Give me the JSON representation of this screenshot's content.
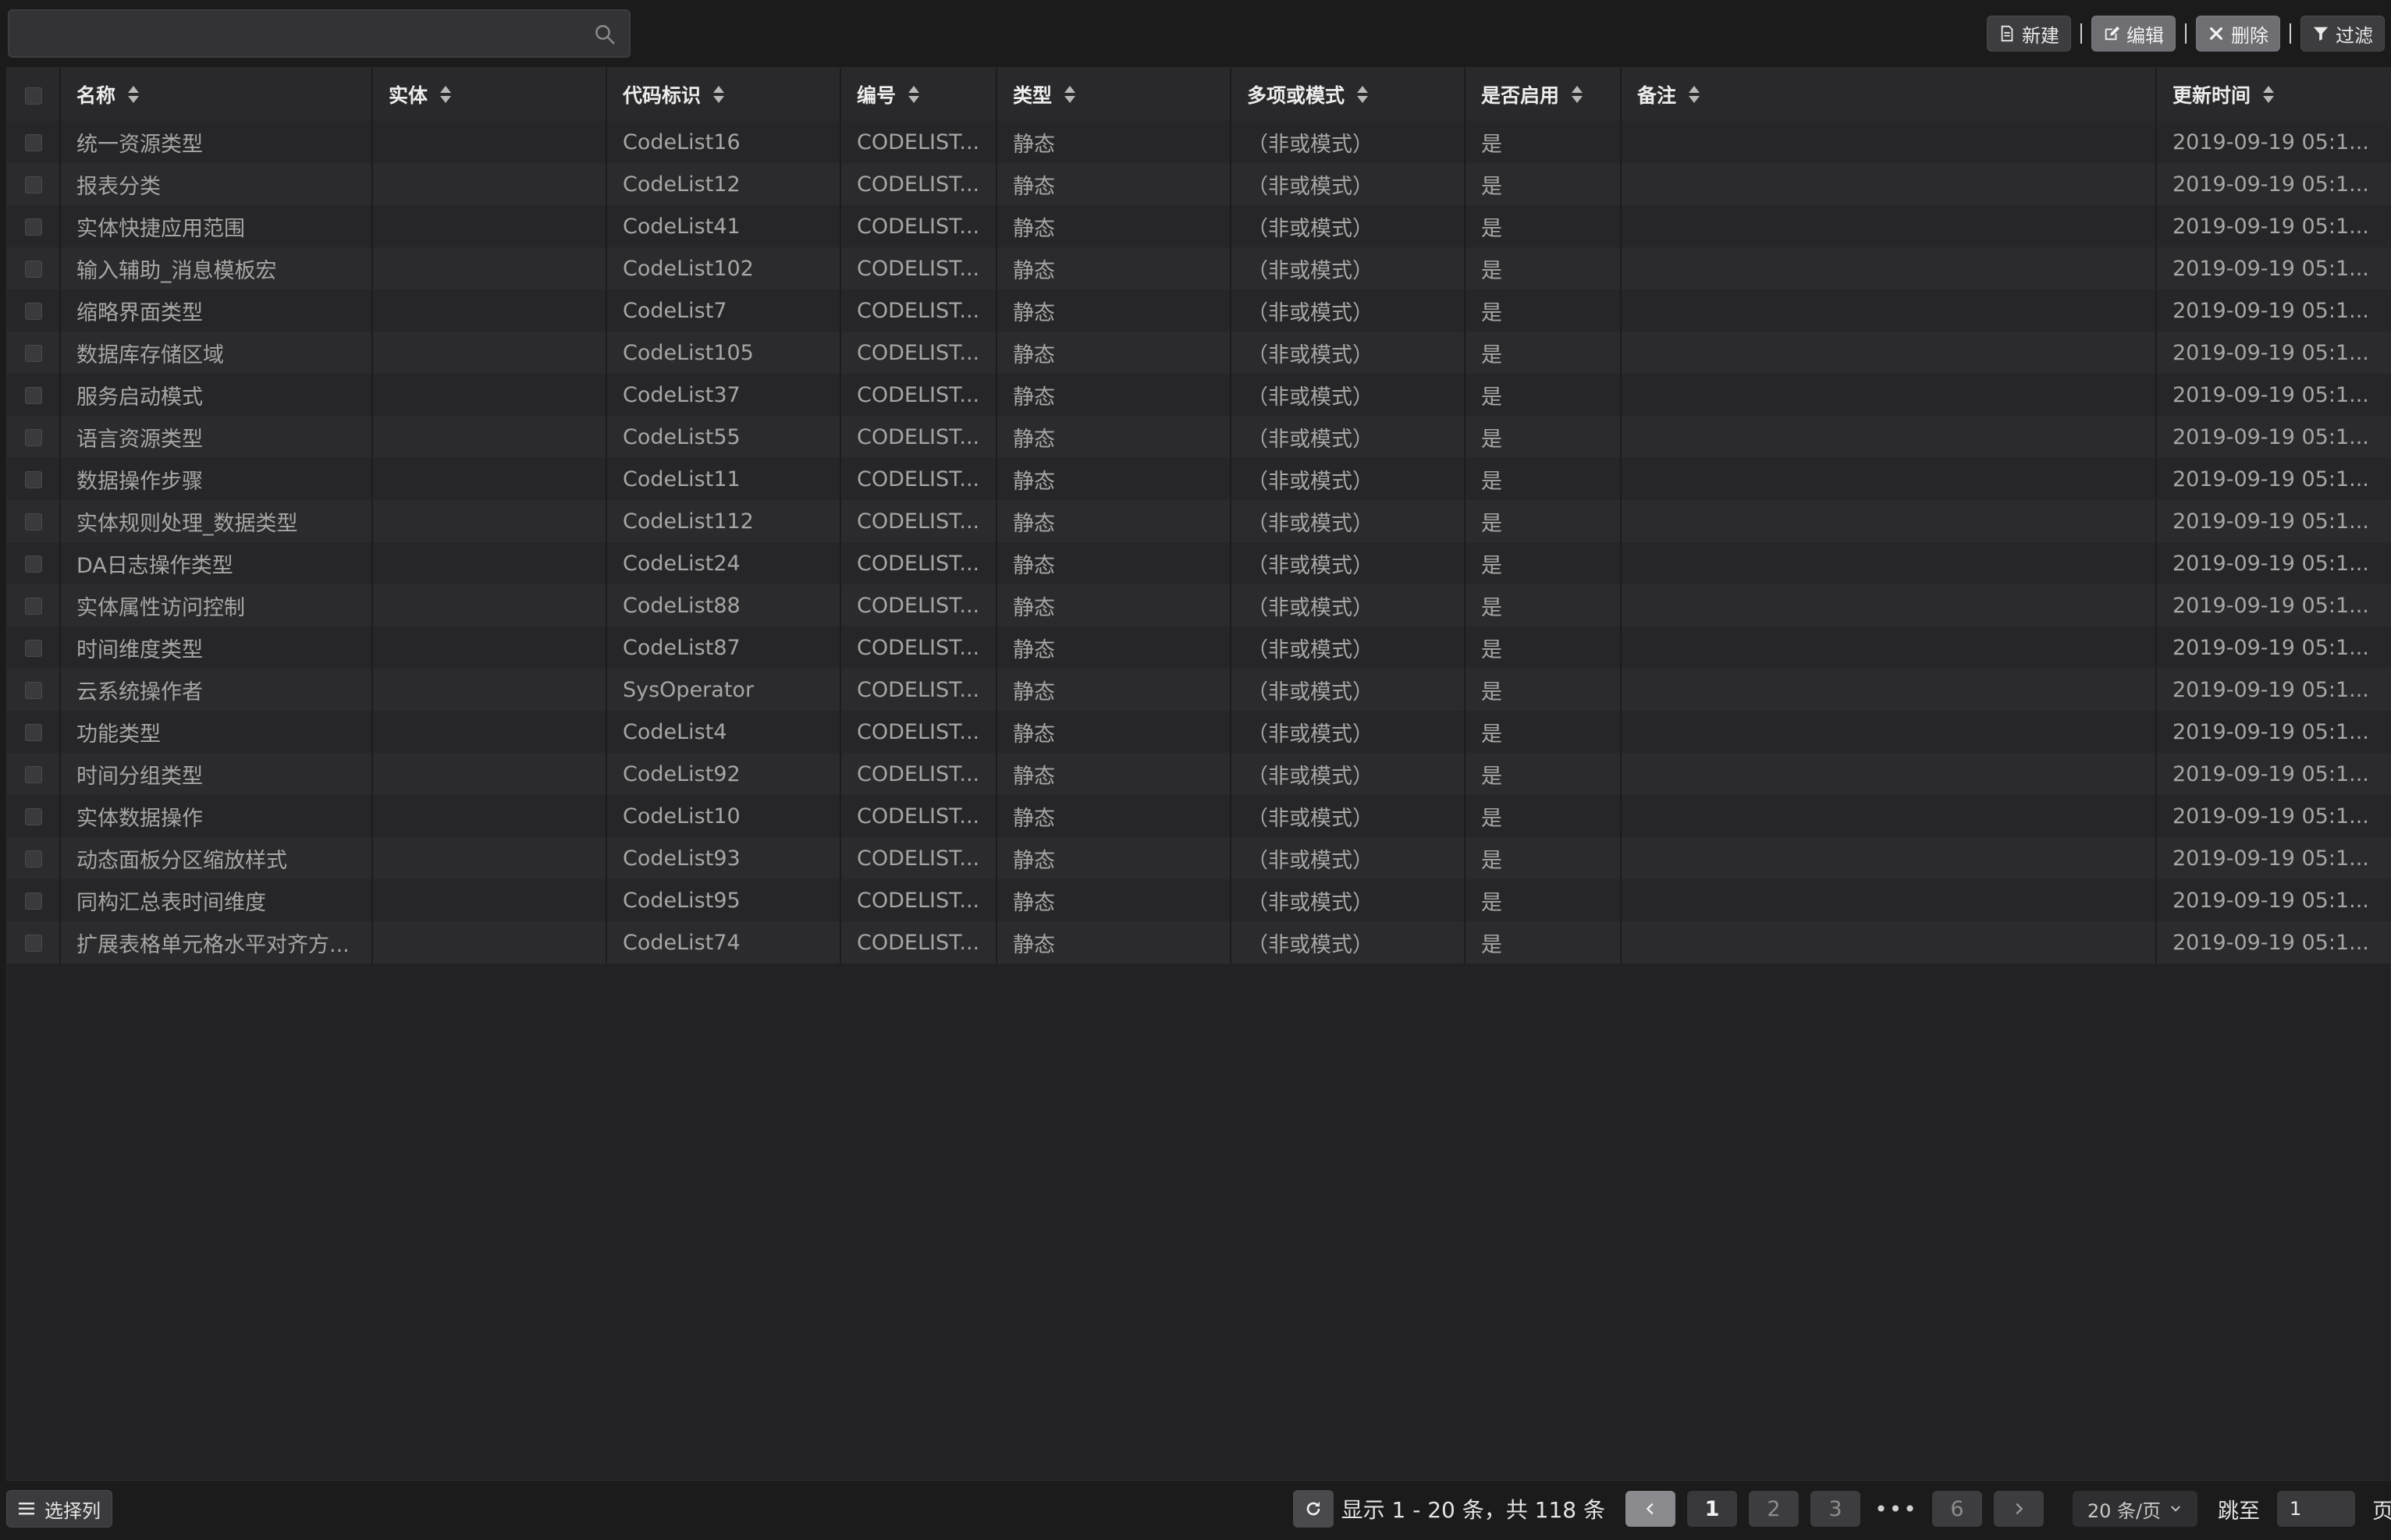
{
  "search": {
    "placeholder": "",
    "value": ""
  },
  "toolbar": {
    "new_label": "新建",
    "edit_label": "编辑",
    "delete_label": "删除",
    "filter_label": "过滤"
  },
  "table": {
    "columns": [
      "名称",
      "实体",
      "代码标识",
      "编号",
      "类型",
      "多项或模式",
      "是否启用",
      "备注",
      "更新时间"
    ],
    "rows": [
      [
        "统一资源类型",
        "",
        "CodeList16",
        "CODELIST...",
        "静态",
        "（非或模式）",
        "是",
        "",
        "2019-09-19 05:1..."
      ],
      [
        "报表分类",
        "",
        "CodeList12",
        "CODELIST...",
        "静态",
        "（非或模式）",
        "是",
        "",
        "2019-09-19 05:1..."
      ],
      [
        "实体快捷应用范围",
        "",
        "CodeList41",
        "CODELIST...",
        "静态",
        "（非或模式）",
        "是",
        "",
        "2019-09-19 05:1..."
      ],
      [
        "输入辅助_消息模板宏",
        "",
        "CodeList102",
        "CODELIST...",
        "静态",
        "（非或模式）",
        "是",
        "",
        "2019-09-19 05:1..."
      ],
      [
        "缩略界面类型",
        "",
        "CodeList7",
        "CODELIST...",
        "静态",
        "（非或模式）",
        "是",
        "",
        "2019-09-19 05:1..."
      ],
      [
        "数据库存储区域",
        "",
        "CodeList105",
        "CODELIST...",
        "静态",
        "（非或模式）",
        "是",
        "",
        "2019-09-19 05:1..."
      ],
      [
        "服务启动模式",
        "",
        "CodeList37",
        "CODELIST...",
        "静态",
        "（非或模式）",
        "是",
        "",
        "2019-09-19 05:1..."
      ],
      [
        "语言资源类型",
        "",
        "CodeList55",
        "CODELIST...",
        "静态",
        "（非或模式）",
        "是",
        "",
        "2019-09-19 05:1..."
      ],
      [
        "数据操作步骤",
        "",
        "CodeList11",
        "CODELIST...",
        "静态",
        "（非或模式）",
        "是",
        "",
        "2019-09-19 05:1..."
      ],
      [
        "实体规则处理_数据类型",
        "",
        "CodeList112",
        "CODELIST...",
        "静态",
        "（非或模式）",
        "是",
        "",
        "2019-09-19 05:1..."
      ],
      [
        "DA日志操作类型",
        "",
        "CodeList24",
        "CODELIST...",
        "静态",
        "（非或模式）",
        "是",
        "",
        "2019-09-19 05:1..."
      ],
      [
        "实体属性访问控制",
        "",
        "CodeList88",
        "CODELIST...",
        "静态",
        "（非或模式）",
        "是",
        "",
        "2019-09-19 05:1..."
      ],
      [
        "时间维度类型",
        "",
        "CodeList87",
        "CODELIST...",
        "静态",
        "（非或模式）",
        "是",
        "",
        "2019-09-19 05:1..."
      ],
      [
        "云系统操作者",
        "",
        "SysOperator",
        "CODELIST...",
        "静态",
        "（非或模式）",
        "是",
        "",
        "2019-09-19 05:1..."
      ],
      [
        "功能类型",
        "",
        "CodeList4",
        "CODELIST...",
        "静态",
        "（非或模式）",
        "是",
        "",
        "2019-09-19 05:1..."
      ],
      [
        "时间分组类型",
        "",
        "CodeList92",
        "CODELIST...",
        "静态",
        "（非或模式）",
        "是",
        "",
        "2019-09-19 05:1..."
      ],
      [
        "实体数据操作",
        "",
        "CodeList10",
        "CODELIST...",
        "静态",
        "（非或模式）",
        "是",
        "",
        "2019-09-19 05:1..."
      ],
      [
        "动态面板分区缩放样式",
        "",
        "CodeList93",
        "CODELIST...",
        "静态",
        "（非或模式）",
        "是",
        "",
        "2019-09-19 05:1..."
      ],
      [
        "同构汇总表时间维度",
        "",
        "CodeList95",
        "CODELIST...",
        "静态",
        "（非或模式）",
        "是",
        "",
        "2019-09-19 05:1..."
      ],
      [
        "扩展表格单元格水平对齐方...",
        "",
        "CodeList74",
        "CODELIST...",
        "静态",
        "（非或模式）",
        "是",
        "",
        "2019-09-19 05:1..."
      ]
    ]
  },
  "footer": {
    "select_columns_label": "选择列",
    "info_text": "显示 1 - 20 条，共 118 条",
    "pages": [
      "1",
      "2",
      "3",
      "6"
    ],
    "ellipsis": "•••",
    "page_size": "20 条/页",
    "jump_label": "跳至",
    "jump_value": "1",
    "page_suffix": "页"
  }
}
